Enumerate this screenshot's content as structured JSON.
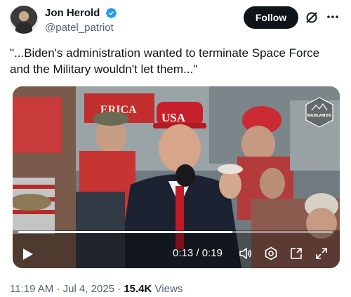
{
  "author": {
    "name": "Jon Herold",
    "handle": "@patel_patriot",
    "verified": true
  },
  "actions": {
    "follow_label": "Follow"
  },
  "tweet": {
    "text": "\"...Biden's administration wanted to terminate Space Force and the Military wouldn't let them...\""
  },
  "video": {
    "time_display": "0:13 / 0:19",
    "progress_fraction": 0.68,
    "watermark": "BADLANDS",
    "icons": [
      "play-icon",
      "volume-icon",
      "settings-icon",
      "pip-icon",
      "fullscreen-icon"
    ]
  },
  "meta": {
    "time": "11:19 AM",
    "separator1": "·",
    "date": "Jul 4, 2025",
    "separator2": "·",
    "views_count": "15.4K",
    "views_label": "Views"
  },
  "colors": {
    "accent_blue": "#1d9bf0",
    "text_primary": "#0f1419",
    "text_secondary": "#536471",
    "follow_bg": "#0f1419"
  }
}
